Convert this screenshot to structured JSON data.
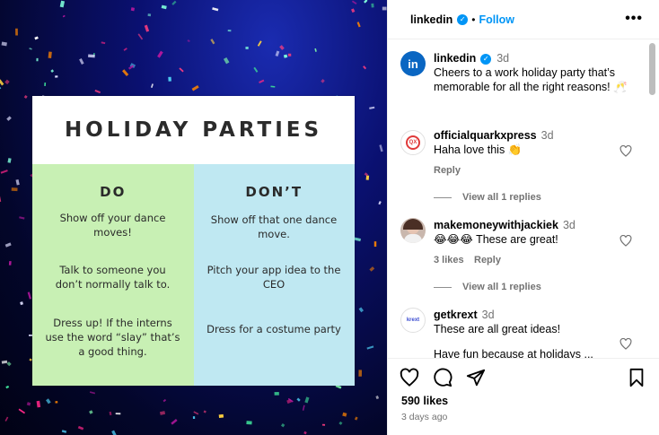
{
  "image": {
    "card_title": "HOLIDAY PARTIES",
    "do_heading": "DO",
    "dont_heading": "DON’T",
    "do_items": [
      "Show off your dance moves!",
      "Talk to someone you don’t normally talk to.",
      "Dress up! If the interns use the word “slay” that’s a good thing."
    ],
    "dont_items": [
      "Show off that one dance move.",
      "Pitch your app idea to the CEO",
      "Dress for a costume party"
    ]
  },
  "header": {
    "username": "linkedin",
    "separator": "•",
    "follow_label": "Follow",
    "more_label": "•••"
  },
  "caption": {
    "username": "linkedin",
    "time": "3d",
    "text": "Cheers to a work holiday party that’s memorable for all the right reasons! 🥂"
  },
  "comments": [
    {
      "username": "officialquarkxpress",
      "time": "3d",
      "text": "Haha love this 👏",
      "reply_label": "Reply",
      "view_replies": "View all 1 replies",
      "avatar_text": "QX"
    },
    {
      "username": "makemoneywithjackiek",
      "time": "3d",
      "text": "😂😂😂 These are great!",
      "likes": "3 likes",
      "reply_label": "Reply",
      "view_replies": "View all 1 replies"
    },
    {
      "username": "getkrext",
      "time": "3d",
      "text": "These are all great ideas!",
      "truncated_text": "Have fun because at holidays ...",
      "avatar_text": "krext"
    }
  ],
  "footer": {
    "likes": "590 likes",
    "date": "3 days ago"
  },
  "colors": {
    "accent": "#0095f6",
    "do_bg": "#c8f0b4",
    "dont_bg": "#bfe8f2",
    "linkedin_blue": "#0a66c2"
  }
}
